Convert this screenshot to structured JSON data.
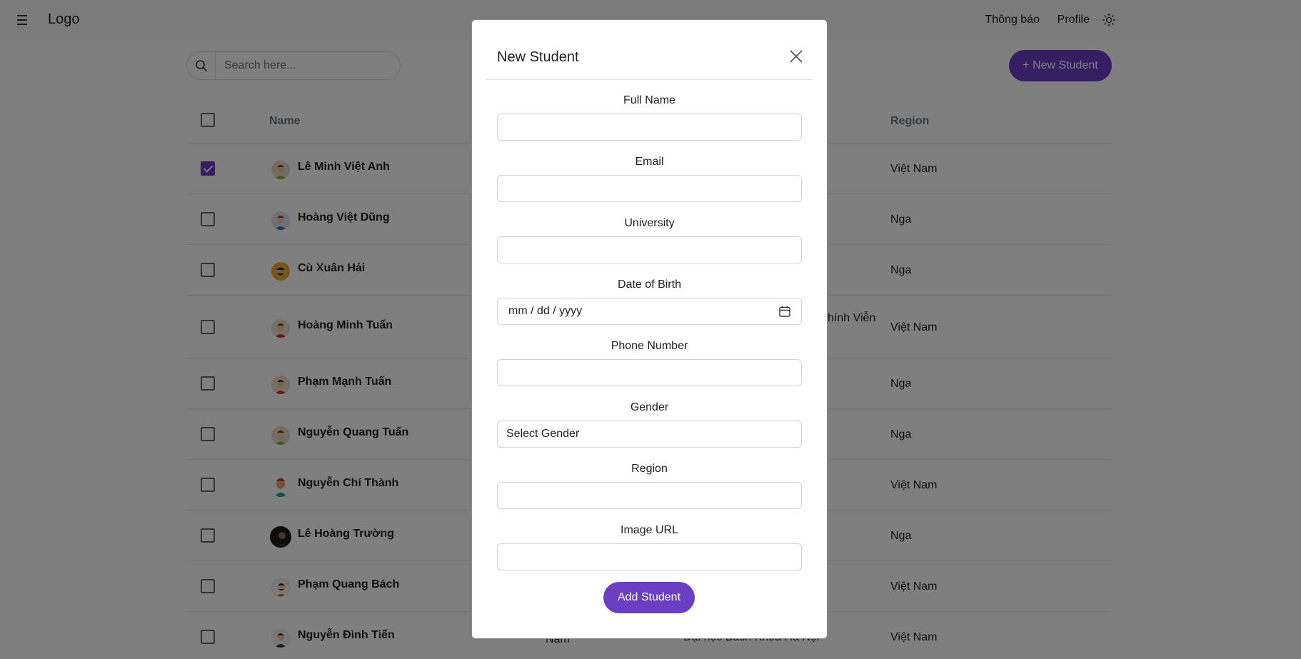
{
  "header": {
    "logo": "Logo",
    "notifications": "Thông báo",
    "profile": "Profile"
  },
  "toolbar": {
    "search_placeholder": "Search here...",
    "new_student_label": "+ New Student"
  },
  "table": {
    "columns": {
      "name": "Name",
      "region": "Region"
    },
    "rows": [
      {
        "name": "Lê Minh Việt Anh",
        "region": "Việt Nam",
        "checked": true
      },
      {
        "name": "Hoàng Việt Dũng",
        "region": "Nga",
        "checked": false
      },
      {
        "name": "Cù Xuân Hải",
        "region": "Nga",
        "checked": false
      },
      {
        "name": "Hoàng Minh Tuấn",
        "region": "Việt Nam",
        "checked": false,
        "university_partial": "hính Viễn"
      },
      {
        "name": "Phạm Mạnh Tuấn",
        "region": "Nga",
        "checked": false
      },
      {
        "name": "Nguyễn Quang Tuấn",
        "region": "Nga",
        "checked": false
      },
      {
        "name": "Nguyễn Chí Thành",
        "region": "Việt Nam",
        "checked": false
      },
      {
        "name": "Lê Hoàng Trường",
        "region": "Nga",
        "checked": false
      },
      {
        "name": "Phạm Quang Bách",
        "region": "Việt Nam",
        "checked": false
      },
      {
        "name": "Nguyễn Đình Tiến",
        "region": "Việt Nam",
        "checked": false,
        "gender": "Nam",
        "university": "Đại học Bách Khoa Hà Nội"
      }
    ]
  },
  "modal": {
    "title": "New Student",
    "fields": {
      "full_name": {
        "label": "Full Name",
        "value": ""
      },
      "email": {
        "label": "Email",
        "value": ""
      },
      "university": {
        "label": "University",
        "value": ""
      },
      "dob": {
        "label": "Date of Birth",
        "placeholder": "mm / dd / yyyy"
      },
      "phone": {
        "label": "Phone Number",
        "value": ""
      },
      "gender": {
        "label": "Gender",
        "selected": "Select Gender"
      },
      "region": {
        "label": "Region",
        "value": ""
      },
      "image_url": {
        "label": "Image URL",
        "value": ""
      }
    },
    "submit_label": "Add Student"
  },
  "colors": {
    "accent": "#6b3fc4",
    "overlay": "rgba(0,0,0,0.5)"
  }
}
